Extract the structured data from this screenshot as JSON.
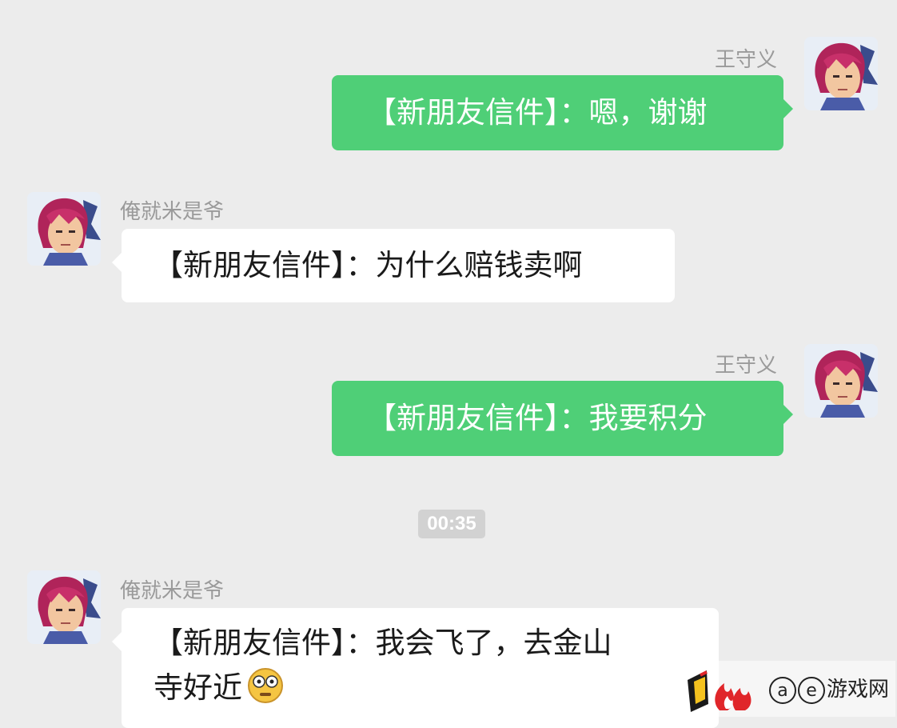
{
  "messages": [
    {
      "sender": "王守义",
      "direction": "outgoing",
      "text": "【新朋友信件】：嗯，谢谢"
    },
    {
      "sender": "俺就米是爷",
      "direction": "incoming",
      "text": "【新朋友信件】：为什么赔钱卖啊"
    },
    {
      "sender": "王守义",
      "direction": "outgoing",
      "text": "【新朋友信件】：我要积分"
    },
    {
      "sender": "俺就米是爷",
      "direction": "incoming",
      "text_line1": "【新朋友信件】：我会飞了，去金山",
      "text_line2": "寺好近",
      "emoji": "flushed-face-icon"
    }
  ],
  "timestamp": "00:35",
  "watermark": {
    "at": "a",
    "e": "e",
    "text": "游戏网"
  },
  "colors": {
    "outgoing_bubble": "#4fcf77",
    "incoming_bubble": "#ffffff",
    "background": "#ececec"
  }
}
